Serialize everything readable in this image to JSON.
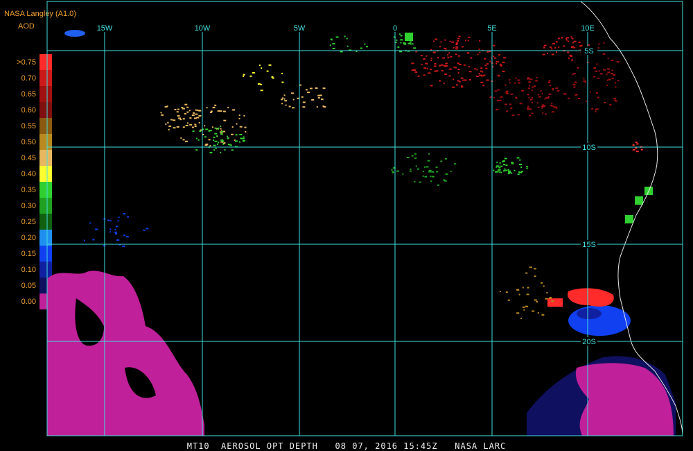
{
  "header": {
    "title": "NASA Langley (A1.0)",
    "parameter": "AOD"
  },
  "legend": {
    "labels": [
      ">0.75",
      "0.70",
      "0.65",
      "0.60",
      "0.55",
      "0.50",
      "0.45",
      "0.40",
      "0.35",
      "0.30",
      "0.25",
      "0.20",
      "0.15",
      "0.10",
      "0.05",
      "0.00"
    ],
    "colors": [
      "#ff2a2a",
      "#cc1a1a",
      "#a01010",
      "#801010",
      "#8a5a10",
      "#b88a20",
      "#e8b860",
      "#ffff30",
      "#30d030",
      "#20a020",
      "#106010",
      "#2090f0",
      "#1040f0",
      "#1020a0",
      "#101060",
      "#c0209a"
    ]
  },
  "grid": {
    "color": "#40e0e0",
    "lon_labels": [
      "15W",
      "10W",
      "5W",
      "0",
      "5E",
      "10E"
    ],
    "lat_labels": [
      "5S",
      "10S",
      "15S",
      "20S"
    ]
  },
  "footer": "MT10  AEROSOL OPT DEPTH   08 07, 2016 15:45Z   NASA LARC"
}
